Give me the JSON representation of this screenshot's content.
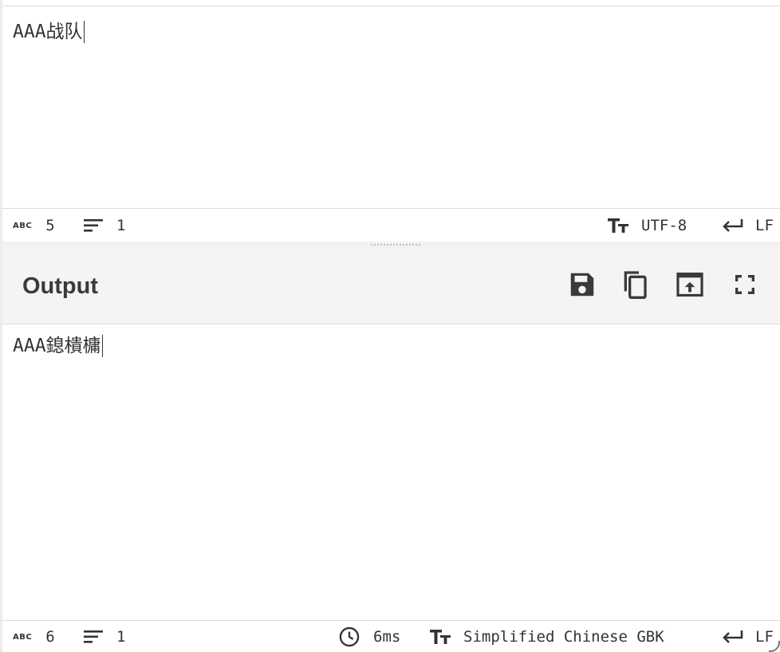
{
  "input": {
    "text": "AAA战队",
    "status": {
      "char_count_icon": "abc-icon",
      "char_count_label": "ABC",
      "char_count": "5",
      "line_count_icon": "lines-icon",
      "line_count": "1",
      "encoding_icon": "text-format-icon",
      "encoding": "UTF-8",
      "eol_icon": "return-arrow-icon",
      "eol": "LF"
    }
  },
  "output": {
    "title": "Output",
    "buttons": [
      {
        "name": "save-output-button",
        "icon": "floppy-disk-icon"
      },
      {
        "name": "copy-output-button",
        "icon": "copy-icon"
      },
      {
        "name": "replace-input-button",
        "icon": "upload-to-input-icon"
      },
      {
        "name": "maximize-output-button",
        "icon": "fullscreen-icon"
      }
    ],
    "text": "AAA鎴樻槦",
    "status": {
      "char_count_label": "ABC",
      "char_count": "6",
      "line_count": "1",
      "time_icon": "clock-icon",
      "time": "6ms",
      "encoding": "Simplified Chinese GBK",
      "eol": "LF"
    }
  },
  "colors": {
    "text": "#333333",
    "header_bg": "#f4f4f4",
    "border": "#dcdcdc"
  }
}
